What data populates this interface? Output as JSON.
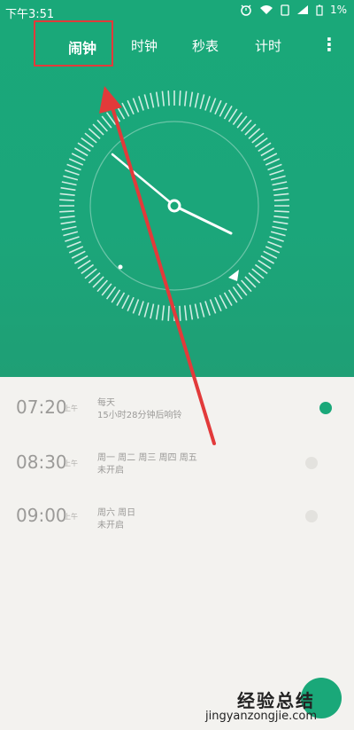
{
  "status_bar": {
    "time": "下午3:51",
    "battery": "1%",
    "icons": [
      "alarm-icon",
      "wifi-icon",
      "sim-icon",
      "signal-icon",
      "battery-icon"
    ]
  },
  "tabs": [
    {
      "label": "闹钟",
      "active": true
    },
    {
      "label": "时钟",
      "active": false
    },
    {
      "label": "秒表",
      "active": false
    },
    {
      "label": "计时",
      "active": false
    }
  ],
  "menu_icon": "more-vertical-icon",
  "colors": {
    "accent": "#1aa879",
    "highlight_box": "#e23a3a",
    "arrow": "#e23a3a"
  },
  "alarms": [
    {
      "time": "07:20",
      "ampm": "上午",
      "repeat": "每天",
      "sub": "15小时28分钟后响铃",
      "enabled": true
    },
    {
      "time": "08:30",
      "ampm": "上午",
      "repeat": "周一 周二 周三 周四 周五",
      "sub": "未开启",
      "enabled": false
    },
    {
      "time": "09:00",
      "ampm": "上午",
      "repeat": "周六 周日",
      "sub": "未开启",
      "enabled": false
    }
  ],
  "fab_icon": "add-icon",
  "watermark": {
    "logo": "经验总结",
    "url": "jingyanzongjie.com"
  }
}
